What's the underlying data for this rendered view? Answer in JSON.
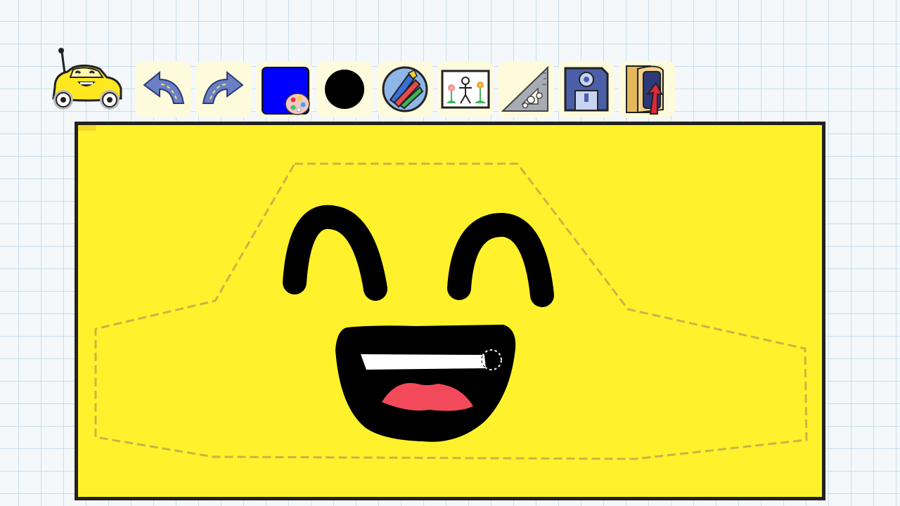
{
  "colors": {
    "canvas": "#fff22c",
    "selected_color": "#0000ff",
    "toolbar_button_bg": "#fdfbdc",
    "ink": "#000000",
    "tongue": "#f24a5a",
    "stamp_outline": "#c8b545"
  },
  "toolbar": {
    "tools": [
      {
        "name": "undo",
        "icon": "undo-arrow-icon"
      },
      {
        "name": "redo",
        "icon": "redo-arrow-icon"
      },
      {
        "name": "color-picker",
        "icon": "color-palette-icon",
        "selected_color": "#0000ff"
      },
      {
        "name": "brush-size",
        "icon": "brush-size-circle-icon"
      },
      {
        "name": "brushes",
        "icon": "brushes-icon"
      },
      {
        "name": "stamps",
        "icon": "stamp-picture-icon"
      },
      {
        "name": "shapes",
        "icon": "shapes-ruler-icon"
      },
      {
        "name": "save",
        "icon": "floppy-disk-icon"
      },
      {
        "name": "exit",
        "icon": "exit-door-icon"
      }
    ]
  },
  "mascot": {
    "icon": "car-mascot-icon"
  },
  "canvas": {
    "cursor": "brush-cursor-icon"
  }
}
